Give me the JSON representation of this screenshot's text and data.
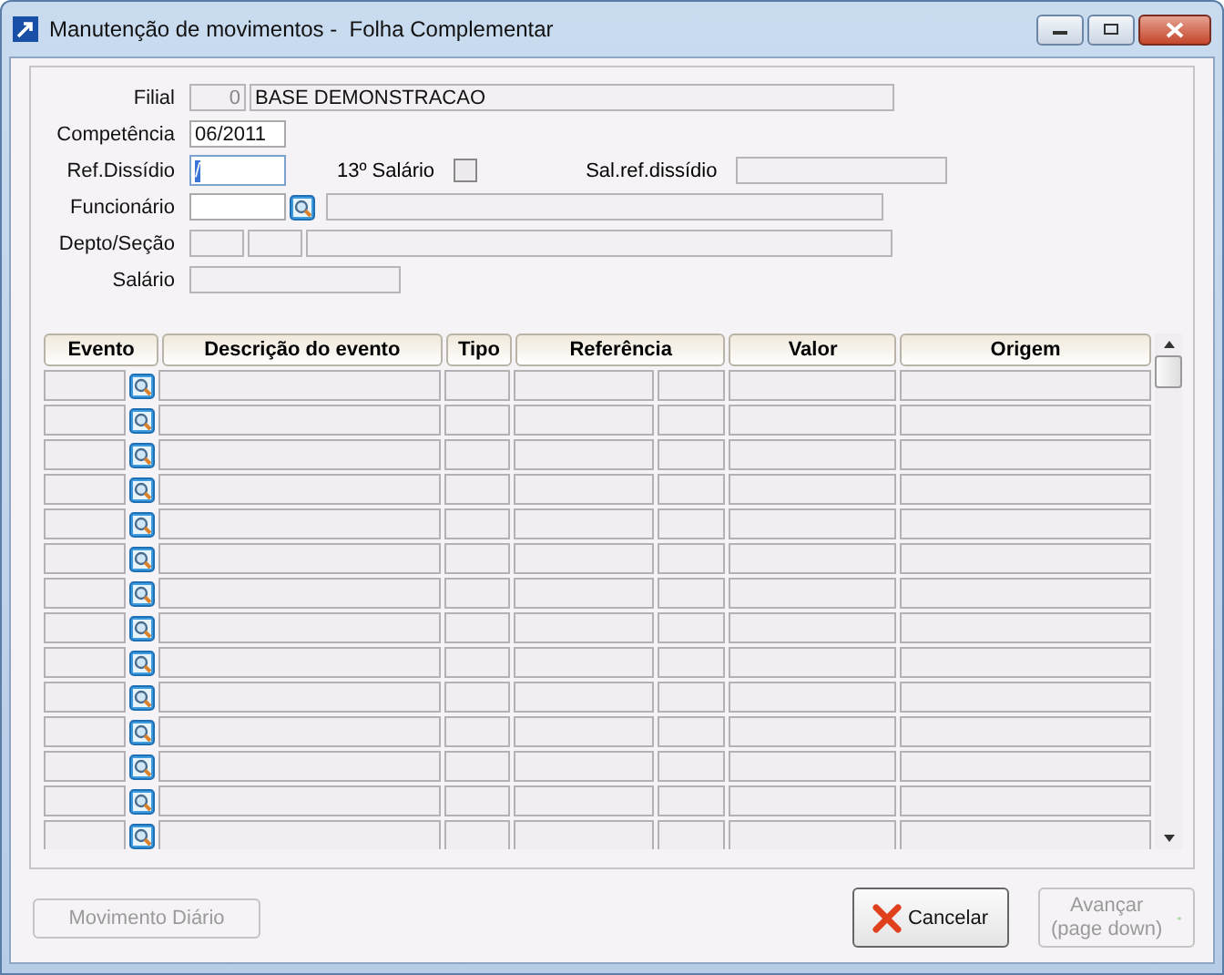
{
  "window": {
    "title": "Manutenção de movimentos -  Folha Complementar"
  },
  "form": {
    "filial": {
      "label": "Filial",
      "code": "0",
      "name": "BASE DEMONSTRACAO"
    },
    "competencia": {
      "label": "Competência",
      "value": "06/2011"
    },
    "ref_dissidio": {
      "label": "Ref.Dissídio",
      "value": "/",
      "text_selected": true
    },
    "salario_13": {
      "label": "13º Salário",
      "checked": false
    },
    "sal_ref_dissidio": {
      "label": "Sal.ref.dissídio"
    },
    "funcionario": {
      "label": "Funcionário"
    },
    "depto_secao": {
      "label": "Depto/Seção"
    },
    "salario": {
      "label": "Salário"
    }
  },
  "table": {
    "columns": [
      "Evento",
      "Descrição do evento",
      "Tipo",
      "Referência",
      "Valor",
      "Origem"
    ],
    "rows": [
      {
        "kind": "empty"
      },
      {
        "kind": "empty"
      },
      {
        "kind": "empty"
      },
      {
        "kind": "empty"
      },
      {
        "kind": "empty"
      },
      {
        "kind": "empty"
      },
      {
        "kind": "empty"
      },
      {
        "kind": "empty"
      },
      {
        "kind": "empty"
      },
      {
        "kind": "empty"
      },
      {
        "kind": "empty"
      },
      {
        "kind": "empty"
      },
      {
        "kind": "empty"
      },
      {
        "kind": "empty"
      }
    ]
  },
  "buttons": [
    {
      "label": "Movimento Diário",
      "kind": "plain",
      "disabled": true
    },
    {
      "label": "Cancelar",
      "kind": "cancel",
      "disabled": false
    },
    {
      "label": "Avançar\n(page down)",
      "kind": "next",
      "disabled": true
    }
  ]
}
